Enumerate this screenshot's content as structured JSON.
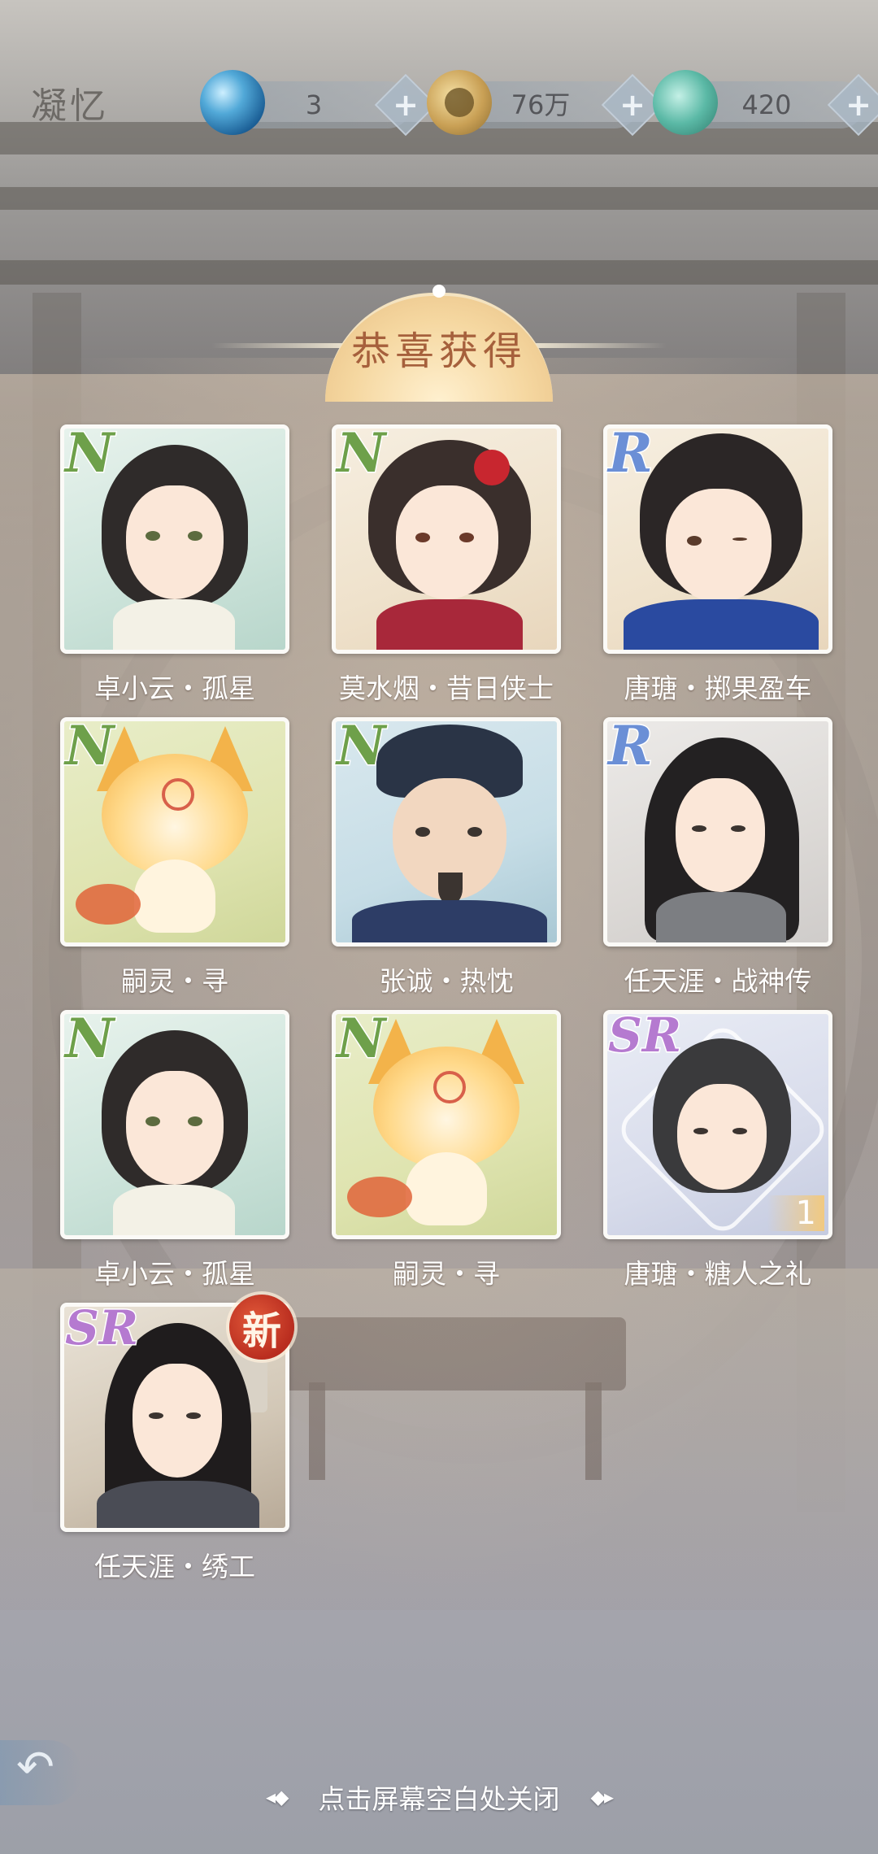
{
  "header": {
    "title": "凝忆",
    "resources": [
      {
        "icon": "blue-pearl-icon",
        "value": "3"
      },
      {
        "icon": "coin-paw-icon",
        "value": "76万"
      },
      {
        "icon": "jade-dragon-icon",
        "value": "420"
      }
    ]
  },
  "banner": {
    "title": "恭喜获得"
  },
  "cards": [
    {
      "rarity": "N",
      "name": "卓小云・孤星"
    },
    {
      "rarity": "N",
      "name": "莫水烟・昔日侠士"
    },
    {
      "rarity": "R",
      "name": "唐瑭・掷果盈车"
    },
    {
      "rarity": "N",
      "name": "嗣灵・寻"
    },
    {
      "rarity": "N",
      "name": "张诚・热忱"
    },
    {
      "rarity": "R",
      "name": "任天涯・战神传"
    },
    {
      "rarity": "N",
      "name": "卓小云・孤星"
    },
    {
      "rarity": "N",
      "name": "嗣灵・寻"
    },
    {
      "rarity": "SR",
      "name": "唐瑭・糖人之礼",
      "count": "1"
    },
    {
      "rarity": "SR",
      "name": "任天涯・绣工",
      "badge": "新"
    }
  ],
  "footer": {
    "hint": "点击屏幕空白处关闭",
    "deco_left": "◂◆",
    "deco_right": "◆▸"
  },
  "colors": {
    "rarity_N": "#6ea04a",
    "rarity_R": "#6b8fd6",
    "rarity_SR": "#b57ad0",
    "banner_text": "#a6603c"
  }
}
